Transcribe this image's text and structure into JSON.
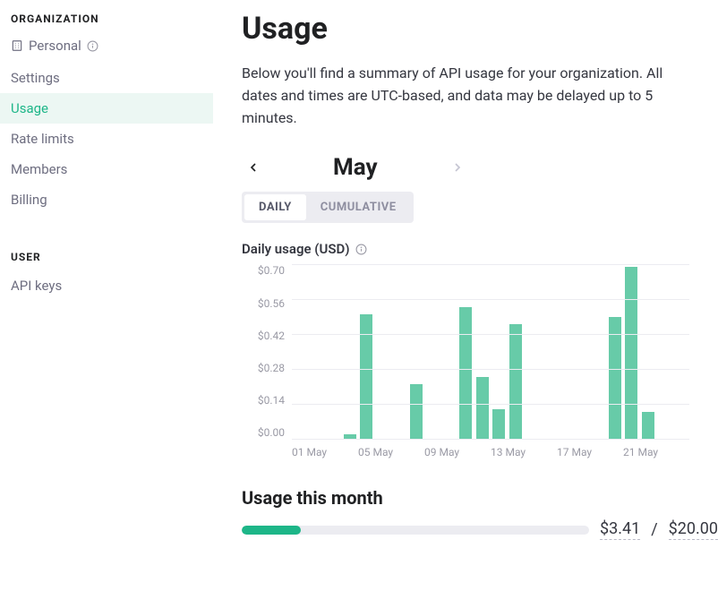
{
  "sidebar": {
    "org_section_title": "ORGANIZATION",
    "breadcrumb": {
      "org_name": "Personal"
    },
    "items": [
      {
        "label": "Settings"
      },
      {
        "label": "Usage"
      },
      {
        "label": "Rate limits"
      },
      {
        "label": "Members"
      },
      {
        "label": "Billing"
      }
    ],
    "user_section_title": "USER",
    "user_items": [
      {
        "label": "API keys"
      }
    ]
  },
  "page": {
    "title": "Usage",
    "intro": "Below you'll find a summary of API usage for your organization. All dates and times are UTC-based, and data may be delayed up to 5 minutes.",
    "month": "May",
    "tabs": {
      "daily": "DAILY",
      "cumulative": "CUMULATIVE"
    },
    "chart_title": "Daily usage (USD)"
  },
  "usage_month": {
    "title": "Usage this month",
    "amount": "$3.41",
    "limit": "$20.00",
    "fill_percent": 17
  },
  "chart_data": {
    "type": "bar",
    "title": "Daily usage (USD)",
    "xlabel": "",
    "ylabel": "",
    "ylim": [
      0.0,
      0.7
    ],
    "y_ticks": [
      "$0.70",
      "$0.56",
      "$0.42",
      "$0.28",
      "$0.14",
      "$0.00"
    ],
    "x_ticks": [
      "01 May",
      "05 May",
      "09 May",
      "13 May",
      "17 May",
      "21 May"
    ],
    "categories": [
      1,
      2,
      3,
      4,
      5,
      6,
      7,
      8,
      9,
      10,
      11,
      12,
      13,
      14,
      15,
      16,
      17,
      18,
      19,
      20,
      21,
      22,
      23,
      24
    ],
    "values": [
      0,
      0,
      0,
      0.02,
      0.5,
      0,
      0,
      0.22,
      0,
      0,
      0.53,
      0.25,
      0.12,
      0.46,
      0,
      0,
      0,
      0,
      0,
      0.49,
      0.69,
      0.11,
      0,
      0
    ]
  }
}
